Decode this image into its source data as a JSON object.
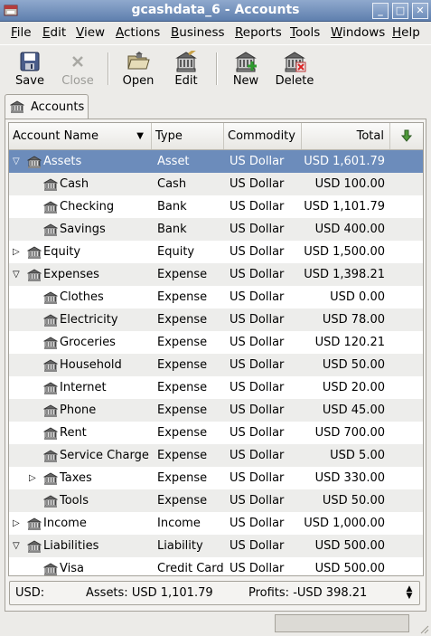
{
  "window": {
    "title": "gcashdata_6 - Accounts",
    "minimize_icon": "minimize-icon",
    "maximize_icon": "maximize-icon",
    "close_icon": "close-icon"
  },
  "menubar": {
    "items": [
      {
        "label": "File",
        "mnemonic": "F"
      },
      {
        "label": "Edit",
        "mnemonic": "E"
      },
      {
        "label": "View",
        "mnemonic": "V"
      },
      {
        "label": "Actions",
        "mnemonic": "A"
      },
      {
        "label": "Business",
        "mnemonic": "B"
      },
      {
        "label": "Reports",
        "mnemonic": "R"
      },
      {
        "label": "Tools",
        "mnemonic": "T"
      },
      {
        "label": "Windows",
        "mnemonic": "W"
      },
      {
        "label": "Help",
        "mnemonic": "H"
      }
    ]
  },
  "toolbar": {
    "save": "Save",
    "close": "Close",
    "open": "Open",
    "edit": "Edit",
    "new": "New",
    "delete": "Delete"
  },
  "tab": {
    "label": "Accounts"
  },
  "columns": {
    "name": "Account Name",
    "type": "Type",
    "commodity": "Commodity",
    "total": "Total"
  },
  "accounts": [
    {
      "name": "Assets",
      "type": "Asset",
      "commodity": "US Dollar",
      "total": "USD 1,601.79",
      "depth": 0,
      "expander": "expanded",
      "selected": true
    },
    {
      "name": "Cash",
      "type": "Cash",
      "commodity": "US Dollar",
      "total": "USD 100.00",
      "depth": 1,
      "expander": "none"
    },
    {
      "name": "Checking",
      "type": "Bank",
      "commodity": "US Dollar",
      "total": "USD 1,101.79",
      "depth": 1,
      "expander": "none"
    },
    {
      "name": "Savings",
      "type": "Bank",
      "commodity": "US Dollar",
      "total": "USD 400.00",
      "depth": 1,
      "expander": "none"
    },
    {
      "name": "Equity",
      "type": "Equity",
      "commodity": "US Dollar",
      "total": "USD 1,500.00",
      "depth": 0,
      "expander": "collapsed"
    },
    {
      "name": "Expenses",
      "type": "Expense",
      "commodity": "US Dollar",
      "total": "USD 1,398.21",
      "depth": 0,
      "expander": "expanded"
    },
    {
      "name": "Clothes",
      "type": "Expense",
      "commodity": "US Dollar",
      "total": "USD 0.00",
      "depth": 1,
      "expander": "none"
    },
    {
      "name": "Electricity",
      "type": "Expense",
      "commodity": "US Dollar",
      "total": "USD 78.00",
      "depth": 1,
      "expander": "none"
    },
    {
      "name": "Groceries",
      "type": "Expense",
      "commodity": "US Dollar",
      "total": "USD 120.21",
      "depth": 1,
      "expander": "none"
    },
    {
      "name": "Household",
      "type": "Expense",
      "commodity": "US Dollar",
      "total": "USD 50.00",
      "depth": 1,
      "expander": "none"
    },
    {
      "name": "Internet",
      "type": "Expense",
      "commodity": "US Dollar",
      "total": "USD 20.00",
      "depth": 1,
      "expander": "none"
    },
    {
      "name": "Phone",
      "type": "Expense",
      "commodity": "US Dollar",
      "total": "USD 45.00",
      "depth": 1,
      "expander": "none"
    },
    {
      "name": "Rent",
      "type": "Expense",
      "commodity": "US Dollar",
      "total": "USD 700.00",
      "depth": 1,
      "expander": "none"
    },
    {
      "name": "Service Charge",
      "type": "Expense",
      "commodity": "US Dollar",
      "total": "USD 5.00",
      "depth": 1,
      "expander": "none"
    },
    {
      "name": "Taxes",
      "type": "Expense",
      "commodity": "US Dollar",
      "total": "USD 330.00",
      "depth": 1,
      "expander": "collapsed"
    },
    {
      "name": "Tools",
      "type": "Expense",
      "commodity": "US Dollar",
      "total": "USD 50.00",
      "depth": 1,
      "expander": "none"
    },
    {
      "name": "Income",
      "type": "Income",
      "commodity": "US Dollar",
      "total": "USD 1,000.00",
      "depth": 0,
      "expander": "collapsed"
    },
    {
      "name": "Liabilities",
      "type": "Liability",
      "commodity": "US Dollar",
      "total": "USD 500.00",
      "depth": 0,
      "expander": "expanded"
    },
    {
      "name": "Visa",
      "type": "Credit Card",
      "commodity": "US Dollar",
      "total": "USD 500.00",
      "depth": 1,
      "expander": "none"
    }
  ],
  "summary": {
    "currency": "USD:",
    "assets": "Assets: USD 1,101.79",
    "profits": "Profits: -USD 398.21"
  },
  "colors": {
    "selection": "#6c8cbb",
    "titlebar": "#6f8ebb"
  }
}
